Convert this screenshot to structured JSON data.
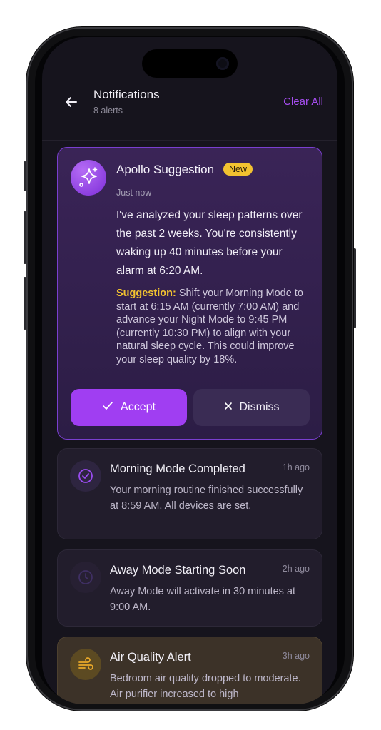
{
  "header": {
    "title": "Notifications",
    "subtitle": "8 alerts",
    "clear_label": "Clear All"
  },
  "apollo": {
    "name": "Apollo Suggestion",
    "badge": "New",
    "time": "Just now",
    "message": "I've analyzed your sleep patterns over the past 2 weeks. You're consistently waking up 40 minutes before your alarm at 6:20 AM.",
    "suggestion_label": "Suggestion:",
    "suggestion_text": "Shift your Morning Mode to start at 6:15 AM (currently 7:00 AM) and advance your Night Mode to 9:45 PM (currently 10:30 PM) to align with your natural sleep cycle. This could improve your sleep quality by 18%.",
    "accept_label": "Accept",
    "dismiss_label": "Dismiss"
  },
  "notifications": [
    {
      "title": "Morning Mode Completed",
      "time": "1h ago",
      "body": "Your morning routine finished successfully at 8:59 AM. All devices are set.",
      "icon": "check-circle-icon"
    },
    {
      "title": "Away Mode Starting Soon",
      "time": "2h ago",
      "body": "Away Mode will activate in 30 minutes at 9:00 AM.",
      "icon": "clock-icon"
    },
    {
      "title": "Air Quality Alert",
      "time": "3h ago",
      "body": "Bedroom air quality dropped to moderate. Air purifier increased to high",
      "icon": "wind-icon"
    }
  ],
  "colors": {
    "accent": "#a03ef2",
    "badge": "#f2c230",
    "background": "#16141d"
  }
}
